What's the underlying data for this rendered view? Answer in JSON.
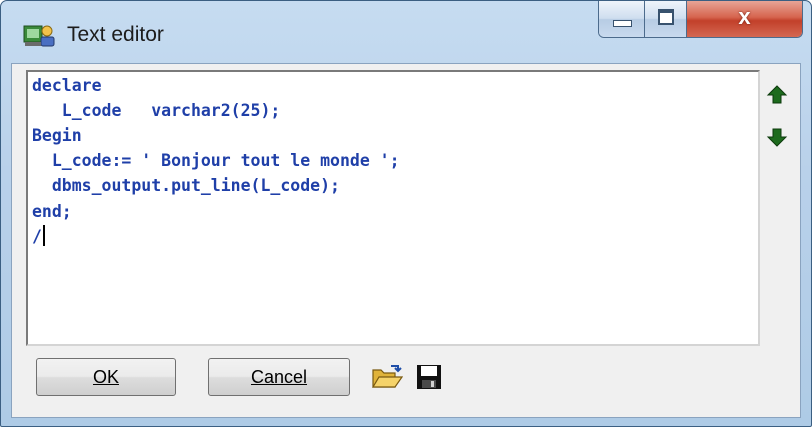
{
  "window": {
    "title": "Text editor",
    "close_glyph": "x",
    "icon": "app-icon"
  },
  "editor": {
    "lines": [
      "declare",
      "   L_code   varchar2(25);",
      "Begin",
      "  L_code:= ' Bonjour tout le monde ';",
      "  dbms_output.put_line(L_code);",
      "end;",
      "/"
    ],
    "text_color": "#1f3fa8"
  },
  "side_buttons": {
    "up_icon": "arrow-up-icon",
    "down_icon": "arrow-down-icon",
    "color": "#1d6b1d"
  },
  "buttons": {
    "ok_label": "OK",
    "cancel_label": "Cancel",
    "open_icon": "folder-open-icon",
    "save_icon": "floppy-save-icon"
  }
}
